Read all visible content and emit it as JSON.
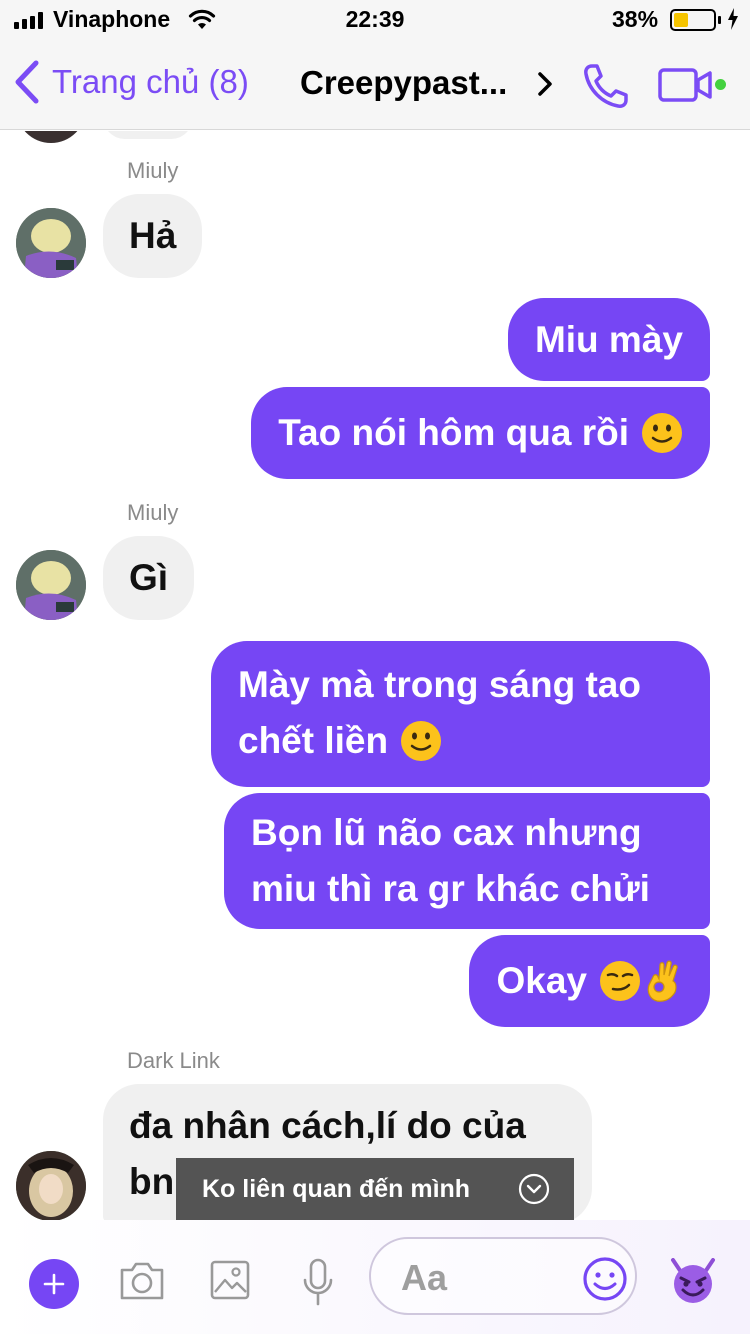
{
  "status_bar": {
    "carrier": "Vinaphone",
    "time": "22:39",
    "battery_percent": "38%",
    "battery_level": 0.38,
    "charging": true
  },
  "nav": {
    "back_label": "Trang chủ (8)",
    "title": "Creepypast...",
    "accent_color": "#7646f4",
    "online_color": "#44d13f"
  },
  "messages": [
    {
      "sender": "Miuly",
      "direction": "in",
      "text": "Hả"
    },
    {
      "direction": "out",
      "text": "Miu mày"
    },
    {
      "direction": "out",
      "text": "Tao nói hôm qua rồi",
      "emoji": "slightly-smiling-face"
    },
    {
      "sender": "Miuly",
      "direction": "in",
      "text": "Gì"
    },
    {
      "direction": "out",
      "lines": [
        "Mày mà trong sáng tao",
        "chết liền"
      ],
      "emoji": "slightly-smiling-face"
    },
    {
      "direction": "out",
      "lines": [
        "Bọn lũ não cax nhưng",
        "miu thì ra gr khác chửi"
      ]
    },
    {
      "direction": "out",
      "text": "Okay",
      "emoji": "smirking-face ok-hand"
    },
    {
      "sender": "Dark Link",
      "direction": "in",
      "lines": [
        "đa nhân cách,lí do của",
        "bn"
      ]
    }
  ],
  "toast": {
    "text": "Ko liên quan đến mình"
  },
  "composer": {
    "placeholder": "Aa"
  }
}
